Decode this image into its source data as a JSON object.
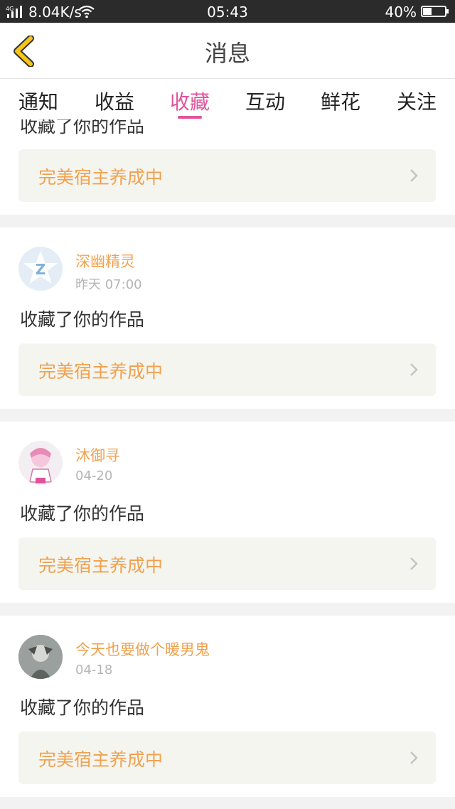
{
  "status_bar": {
    "network": "4G",
    "speed": "8.04K/s",
    "time": "05:43",
    "battery": "40%",
    "battery_level": 0.4
  },
  "header": {
    "title": "消息",
    "back_icon": "chevron-left-icon",
    "accent_color": "#f5c518"
  },
  "tabs": [
    {
      "label": "通知"
    },
    {
      "label": "收益"
    },
    {
      "label": "收藏",
      "active": true
    },
    {
      "label": "互动"
    },
    {
      "label": "鲜花"
    },
    {
      "label": "关注"
    }
  ],
  "active_color": "#e0539b",
  "messages": [
    {
      "username": "",
      "date": "",
      "action": "收藏了你的作品",
      "work_title": "完美宿主养成中"
    },
    {
      "username": "深幽精灵",
      "date": "昨天 07:00",
      "action": "收藏了你的作品",
      "work_title": "完美宿主养成中"
    },
    {
      "username": "沐御寻",
      "date": "04-20",
      "action": "收藏了你的作品",
      "work_title": "完美宿主养成中"
    },
    {
      "username": "今天也要做个暖男鬼",
      "date": "04-18",
      "action": "收藏了你的作品",
      "work_title": "完美宿主养成中"
    }
  ]
}
